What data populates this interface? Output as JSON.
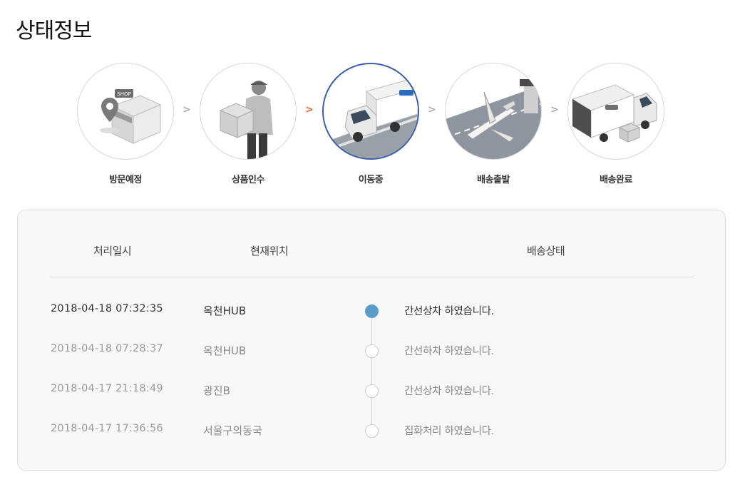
{
  "page_title": "상태정보",
  "colors": {
    "active_step_border": "#3a5fa8",
    "active_arrow": "#e8642c",
    "current_dot": "#5b9dc9"
  },
  "steps": [
    {
      "label": "방문예정",
      "icon": "shop-location-icon",
      "active": false
    },
    {
      "label": "상품인수",
      "icon": "courier-box-icon",
      "active": false
    },
    {
      "label": "이동중",
      "icon": "delivery-truck-icon",
      "active": true
    },
    {
      "label": "배송출발",
      "icon": "airplane-icon",
      "active": false
    },
    {
      "label": "배송완료",
      "icon": "unloading-truck-icon",
      "active": false
    }
  ],
  "table": {
    "headers": {
      "time": "처리일시",
      "location": "현재위치",
      "status": "배송상태"
    },
    "rows": [
      {
        "time": "2018-04-18 07:32:35",
        "location": "옥천HUB",
        "status": "간선상차 하였습니다.",
        "current": true
      },
      {
        "time": "2018-04-18 07:28:37",
        "location": "옥천HUB",
        "status": "간선하차 하였습니다.",
        "current": false
      },
      {
        "time": "2018-04-17 21:18:49",
        "location": "광진B",
        "status": "간선상차 하였습니다.",
        "current": false
      },
      {
        "time": "2018-04-17 17:36:56",
        "location": "서울구의동국",
        "status": "집화처리 하였습니다.",
        "current": false
      }
    ]
  }
}
